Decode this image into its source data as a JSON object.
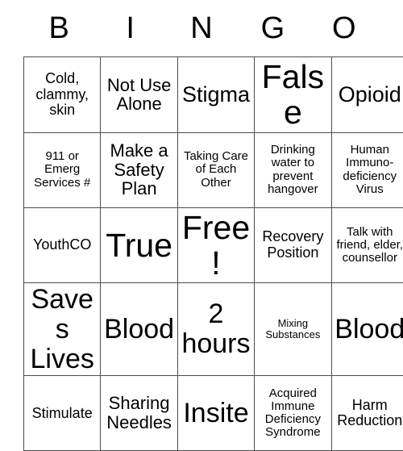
{
  "card": {
    "header_letters": [
      "B",
      "I",
      "N",
      "G",
      "O"
    ],
    "rows": [
      [
        {
          "text": "Cold, clammy, skin",
          "size": "m"
        },
        {
          "text": "Not Use Alone",
          "size": "l"
        },
        {
          "text": "Stigma",
          "size": "xl"
        },
        {
          "text": "False",
          "size": "huge"
        },
        {
          "text": "Opioid",
          "size": "xl"
        }
      ],
      [
        {
          "text": "911 or Emerg Services #",
          "size": "s"
        },
        {
          "text": "Make a Safety Plan",
          "size": "l"
        },
        {
          "text": "Taking Care of Each Other",
          "size": "s"
        },
        {
          "text": "Drinking water to prevent hangover",
          "size": "s"
        },
        {
          "text": "Human Immuno-deficiency Virus",
          "size": "s"
        }
      ],
      [
        {
          "text": "YouthCO",
          "size": "m"
        },
        {
          "text": "True",
          "size": "huge"
        },
        {
          "text": "Free!",
          "size": "huge"
        },
        {
          "text": "Recovery Position",
          "size": "m"
        },
        {
          "text": "Talk with friend, elder, counsellor",
          "size": "s"
        }
      ],
      [
        {
          "text": "Saves Lives",
          "size": "xxl"
        },
        {
          "text": "Blood",
          "size": "xxl"
        },
        {
          "text": "2 hours",
          "size": "xxl"
        },
        {
          "text": "Mixing Substances",
          "size": "xs"
        },
        {
          "text": "Blood",
          "size": "xxl"
        }
      ],
      [
        {
          "text": "Stimulate",
          "size": "m"
        },
        {
          "text": "Sharing Needles",
          "size": "l"
        },
        {
          "text": "Insite",
          "size": "xxl"
        },
        {
          "text": "Acquired Immune Deficiency Syndrome",
          "size": "s"
        },
        {
          "text": "Harm Reduction",
          "size": "m"
        }
      ]
    ]
  },
  "colors": {
    "background": "#ffffff",
    "text": "#000000",
    "grid_border": "#4d4d4d"
  }
}
